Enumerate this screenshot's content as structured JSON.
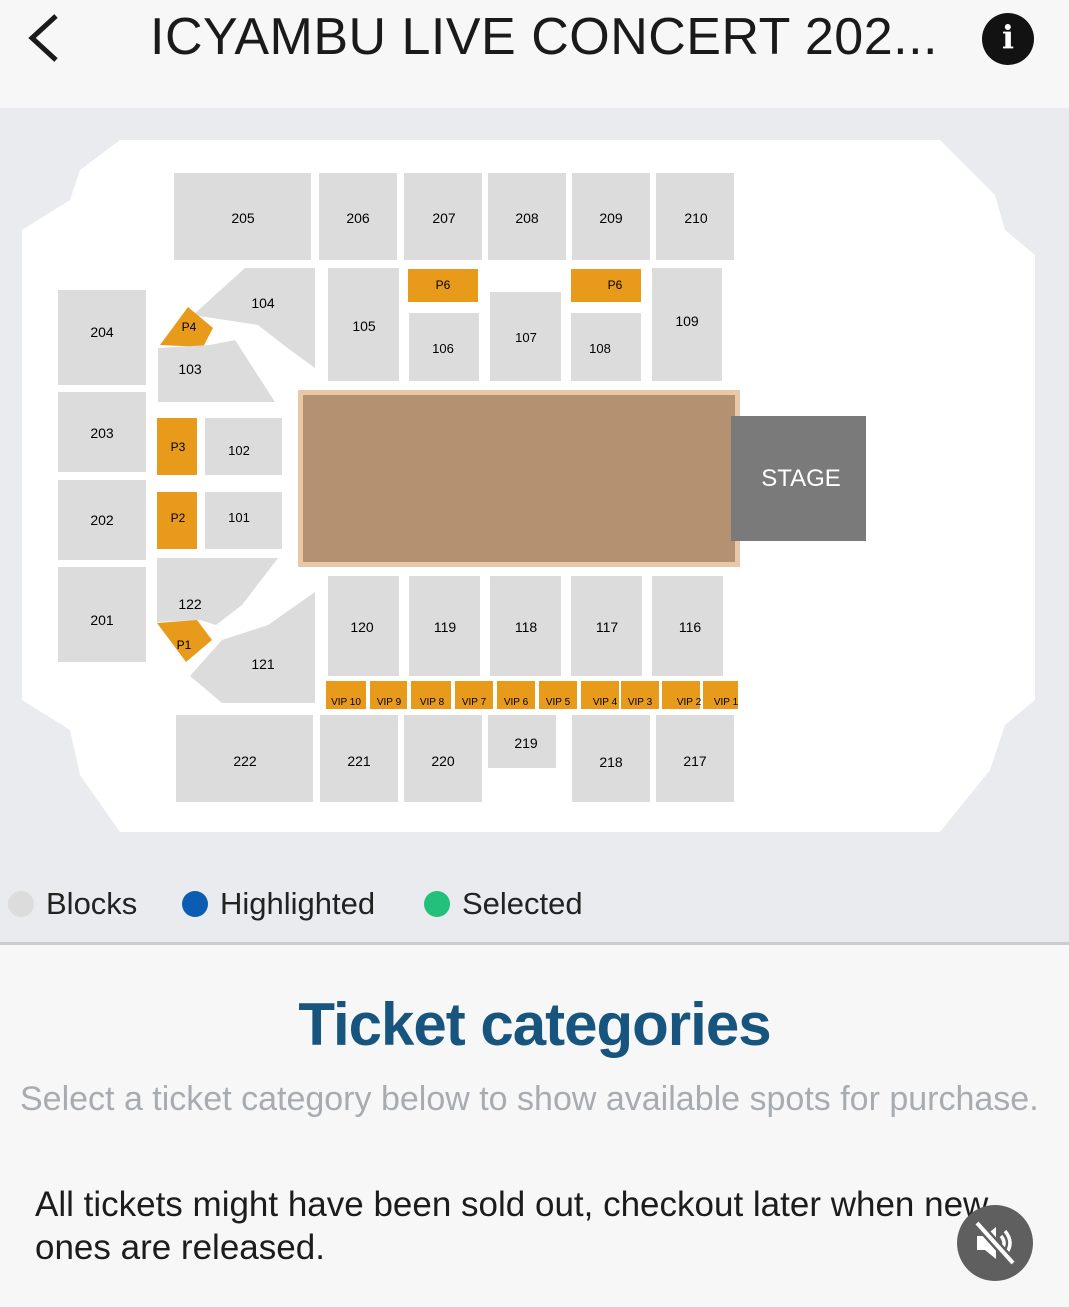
{
  "header": {
    "title": "ICYAMBU LIVE CONCERT 202..."
  },
  "icons": {
    "back": "chevron-left-icon",
    "info": "info-icon",
    "mute": "speaker-muted-icon"
  },
  "map": {
    "stage_label": "STAGE",
    "sections": {
      "s205": "205",
      "s206": "206",
      "s207": "207",
      "s208": "208",
      "s209": "209",
      "s210": "210",
      "s204": "204",
      "s203": "203",
      "s202": "202",
      "s201": "201",
      "s104": "104",
      "s103": "103",
      "s105": "105",
      "s106": "106",
      "s107": "107",
      "s108": "108",
      "s109": "109",
      "s102": "102",
      "s101": "101",
      "s122": "122",
      "s121": "121",
      "s120": "120",
      "s119": "119",
      "s118": "118",
      "s117": "117",
      "s116": "116",
      "s222": "222",
      "s221": "221",
      "s220": "220",
      "s219": "219",
      "s218": "218",
      "s217": "217",
      "p6a": "P6",
      "p6b": "P6",
      "p4": "P4",
      "p3": "P3",
      "p2": "P2",
      "p1": "P1",
      "vip10": "VIP 10",
      "vip9": "VIP 9",
      "vip8": "VIP 8",
      "vip7": "VIP 7",
      "vip6": "VIP 6",
      "vip5": "VIP 5",
      "vip4": "VIP 4",
      "vip3": "VIP 3",
      "vip2": "VIP 2",
      "vip1": "VIP 1"
    },
    "colors": {
      "block": "#dcdcdc",
      "premium": "#e89a1a",
      "floor": "#b39171",
      "floor_border": "#e8c8a8",
      "stage": "#7a7a7a"
    }
  },
  "legend": {
    "blocks": {
      "label": "Blocks",
      "color": "#dcdcdc"
    },
    "highlighted": {
      "label": "Highlighted",
      "color": "#0a5db0"
    },
    "selected": {
      "label": "Selected",
      "color": "#22c07a"
    }
  },
  "tickets": {
    "title": "Ticket categories",
    "subtitle": "Select a ticket category below to show available spots for purchase.",
    "note": "All tickets might have been sold out, checkout later when new ones are released."
  }
}
